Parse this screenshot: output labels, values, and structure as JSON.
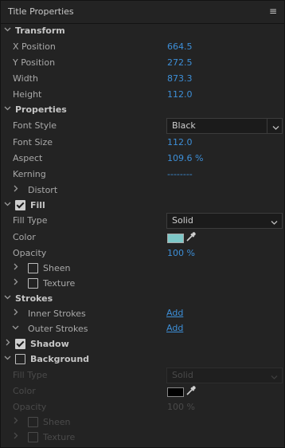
{
  "panel": {
    "title": "Title Properties",
    "menu_icon": "hamburger-icon"
  },
  "transform": {
    "label": "Transform",
    "x_label": "X Position",
    "x_value": "664.5",
    "y_label": "Y Position",
    "y_value": "272.5",
    "w_label": "Width",
    "w_value": "873.3",
    "h_label": "Height",
    "h_value": "112.0"
  },
  "properties": {
    "label": "Properties",
    "font_style_label": "Font Style",
    "font_style_value": "Black",
    "font_size_label": "Font Size",
    "font_size_value": "112.0",
    "aspect_label": "Aspect",
    "aspect_value": "109.6 %",
    "kerning_label": "Kerning",
    "kerning_value": "--------",
    "distort_label": "Distort"
  },
  "fill": {
    "label": "Fill",
    "checked": true,
    "fill_type_label": "Fill Type",
    "fill_type_value": "Solid",
    "color_label": "Color",
    "color_hex": "#7ec8c8",
    "opacity_label": "Opacity",
    "opacity_value": "100 %",
    "sheen_label": "Sheen",
    "texture_label": "Texture"
  },
  "strokes": {
    "label": "Strokes",
    "inner_label": "Inner Strokes",
    "inner_add": "Add",
    "outer_label": "Outer Strokes",
    "outer_add": "Add"
  },
  "shadow": {
    "label": "Shadow",
    "checked": true
  },
  "background": {
    "label": "Background",
    "checked": false,
    "fill_type_label": "Fill Type",
    "fill_type_value": "Solid",
    "color_label": "Color",
    "color_hex": "#000000",
    "opacity_label": "Opacity",
    "opacity_value": "100 %",
    "sheen_label": "Sheen",
    "texture_label": "Texture"
  }
}
